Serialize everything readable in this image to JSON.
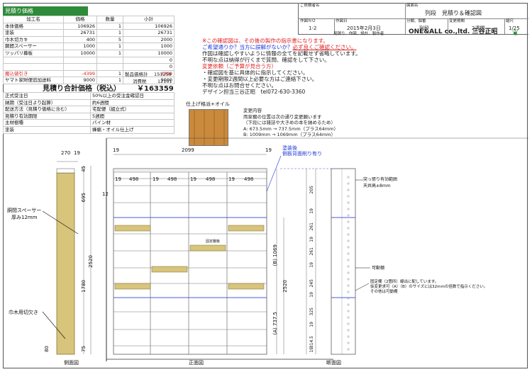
{
  "estimate": {
    "title": "見積り価格",
    "headers": [
      "加工名",
      "価格",
      "数量",
      "小計"
    ],
    "rows": [
      {
        "name": "本体価格",
        "price": "106926",
        "qty": "1",
        "sub": "106926",
        "red": false
      },
      {
        "name": "塗装",
        "price": "26731",
        "qty": "1",
        "sub": "26731",
        "red": false
      },
      {
        "name": "巾木切カキ",
        "price": "400",
        "qty": "5",
        "sub": "2000",
        "red": false
      },
      {
        "name": "胴間スペーサー",
        "price": "1000",
        "qty": "1",
        "sub": "1000",
        "red": false
      },
      {
        "name": "ツッパリ幕板",
        "price": "10000",
        "qty": "1",
        "sub": "10000",
        "red": false
      },
      {
        "name": "",
        "price": "",
        "qty": "",
        "sub": "0",
        "red": false
      },
      {
        "name": "",
        "price": "",
        "qty": "",
        "sub": "0",
        "red": false
      },
      {
        "name": "搬込値引き",
        "price": "-4399",
        "qty": "1",
        "sub": "-4399",
        "red": true
      },
      {
        "name": "ヤマト家財便追加送料",
        "price": "9000",
        "qty": "1",
        "sub": "9000",
        "red": false
      }
    ],
    "subtotal_label": "製品価格計",
    "subtotal_value": "151258",
    "tax_label": "消費税",
    "tax_value": "12101",
    "total_label": "見積り合計価格（税込）",
    "total_value": "￥163359",
    "info": [
      {
        "k": "正式受注日",
        "v": "50%以上の受注金確認日"
      },
      {
        "k": "納期（受注日より起算）",
        "v": "約6週間"
      },
      {
        "k": "配送方法（見積り価格に含む）",
        "v": "宅配便（組立式）"
      },
      {
        "k": "見積り有効期限",
        "v": "5週間"
      },
      {
        "k": "主材樹種",
        "v": "パイン材"
      },
      {
        "k": "塗装",
        "v": "蜂蝋・オイル仕上げ"
      }
    ]
  },
  "titleblock": {
    "client_label": "ご依頼者名",
    "drawing_name_label": "図面名",
    "drawing_name": "列段　見積り＆確認図",
    "no_label": "作図ＮＯ",
    "no": "1-2",
    "date_label": "作図日",
    "date": "2015年2月3日",
    "cat_label": "分類、個番",
    "cat": "列段",
    "period_label": "変更期間",
    "period": "2週間",
    "scale_label": "縮尺",
    "scale": "1/25",
    "footer_note": "見積り、作図、設計、製作者",
    "company": "ONE&ALL co.,ltd. 三谷正昭"
  },
  "notes": {
    "l1": "※この確認図は、その後の製作の指示書になります。",
    "l2a": "ご希望通りか？当方に誤解がないか？",
    "l2b": "必ず良くご確認ください。",
    "l3": "作図は確認しやすいように情報の全てを記載せず省略しています。",
    "l4": "不明な点は納得が行くまで質問、確認をして下さい。",
    "l5": "変更依頼（ご予算が見合う方）",
    "l6": "・確認図を基に具体的に指示してください。",
    "l7": "・変更期限2週間以上必要な方はご連絡下さい。",
    "l8": "不明な点はお問合せください。",
    "l9": "デザイン担当三谷正昭　tel072-630-3360"
  },
  "finish": {
    "label": "仕上げ格派+オイル",
    "color": "#c98a3d"
  },
  "change": {
    "title": "変更内容",
    "l1": "両家棚の位置は次の通り変更願います",
    "l2": "（下段には雑誌や大きめの本を納めるため）",
    "l3": "A: 673.5mm → 737.5mm（プラス64mm）",
    "l4": "B: 1009mm → 1069mm（プラス64mm）"
  },
  "drawing": {
    "side_width": "270",
    "side_gap": "19",
    "total_width": "2099",
    "bay_w": "498",
    "gap19": "19",
    "h_2520": "2520",
    "h_695": "695",
    "h_1780": "1780",
    "h_45": "45",
    "h_12": "12",
    "h_80": "80",
    "h_75": "75",
    "b_label": "(B) 1069",
    "a_label": "(A) 737.5",
    "spacer": "胴間スペーサー",
    "spacer2": "厚み12mm",
    "kiri": "巾木用切欠き",
    "side_view": "側面図",
    "front_view": "正面図",
    "section_view": "断面図",
    "shelf_fixed": "固定棚板",
    "paint_note1": "塗装後",
    "paint_note2": "側板背面削り有り",
    "top_note1": "突っ張り有効範囲",
    "top_note2": "天井高±8mm",
    "movable": "可動棚",
    "fixed_note1": "固定棚（2箇所）線出に配しています。",
    "fixed_note2": "仮変更求可（A）（B）のサイズには32mmの倍数で指示ください。",
    "fixed_note3": "その他は可動棚",
    "sec_dims": [
      "205",
      "19",
      "261",
      "19",
      "261",
      "19",
      "245",
      "19",
      "325",
      "19",
      "314.5",
      "19"
    ]
  }
}
